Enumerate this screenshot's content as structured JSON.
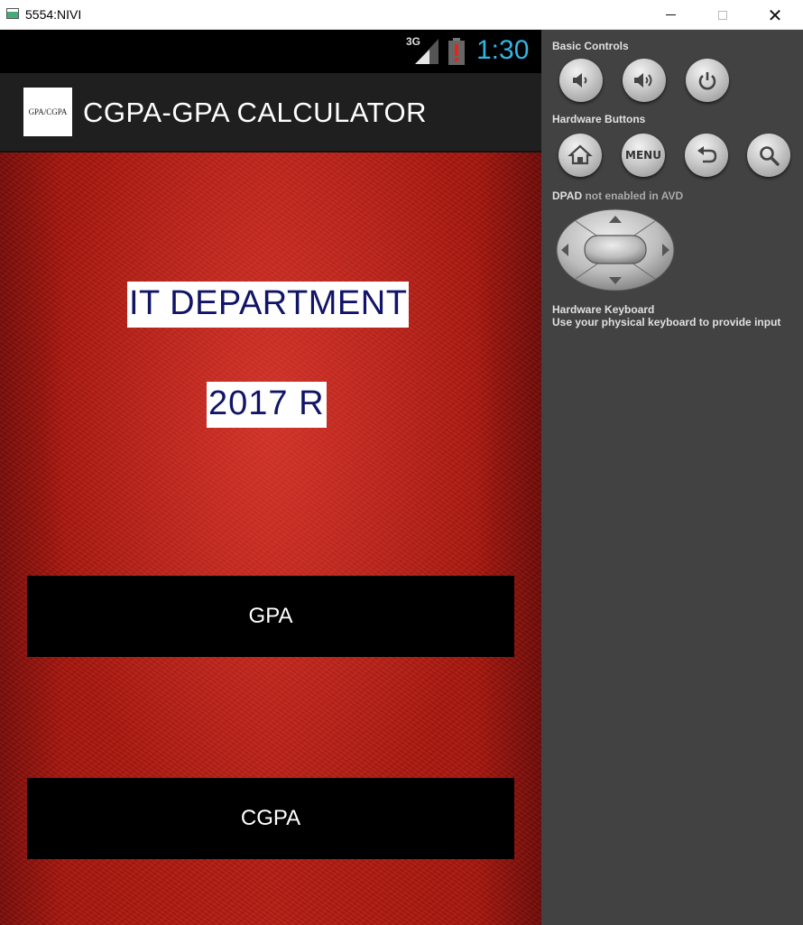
{
  "window": {
    "title": "5554:NIVI"
  },
  "status_bar": {
    "network": "3G",
    "time": "1:30",
    "time_color": "#33b5e5"
  },
  "action_bar": {
    "logo_text": "GPA/CGPA",
    "title": "CGPA-GPA CALCULATOR"
  },
  "main": {
    "department": "IT  DEPARTMENT",
    "regulation": "2017  R",
    "text_color": "#111467",
    "buttons": [
      {
        "label": "GPA"
      },
      {
        "label": "CGPA"
      }
    ]
  },
  "controls": {
    "basic_controls_label": "Basic Controls",
    "basic_buttons": [
      "volume-down-icon",
      "volume-up-icon",
      "power-icon"
    ],
    "hardware_buttons_label": "Hardware Buttons",
    "hardware_buttons": [
      "home-icon",
      "menu",
      "back-icon",
      "search-icon"
    ],
    "menu_label": "MENU",
    "dpad_label": "DPAD",
    "dpad_note": "not enabled in AVD",
    "keyboard_label": "Hardware Keyboard",
    "keyboard_note": "Use your physical keyboard to provide input"
  }
}
